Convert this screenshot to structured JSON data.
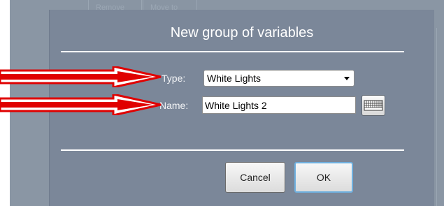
{
  "background": {
    "tabs": [
      "Remove",
      "Move to"
    ]
  },
  "dialog": {
    "title": "New group of variables",
    "type_label": "Type:",
    "type_value": "White Lights",
    "name_label": "Name:",
    "name_value": "White Lights 2",
    "cancel_label": "Cancel",
    "ok_label": "OK"
  },
  "colors": {
    "dialog_bg": "#7b8799",
    "app_bg": "#8a96a4",
    "annotation_arrow": "#e00000",
    "ok_focus_border": "#6fb0df"
  },
  "icons": {
    "keyboard": "keyboard-icon",
    "select_arrow": "chevron-down-icon",
    "annotation": "arrow-right-icon"
  }
}
